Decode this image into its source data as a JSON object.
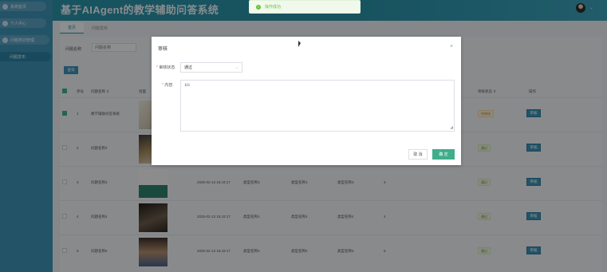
{
  "header": {
    "app_title": "基于AIAgent的教学辅助问答系统",
    "avatar_caret": "⌄"
  },
  "toast": {
    "icon": "✓",
    "text": "操作成功"
  },
  "sidebar": {
    "items": [
      {
        "label": "系统首页"
      },
      {
        "label": "个人中心"
      },
      {
        "label": "问题类别管理"
      },
      {
        "label": "问题发布"
      }
    ]
  },
  "tabs": [
    {
      "label": "首页"
    },
    {
      "label": "问题发布"
    }
  ],
  "search": {
    "label": "问题名称",
    "placeholder": "问题名称",
    "button": "查询"
  },
  "table": {
    "headers": {
      "index": "序号",
      "name": "问题名称 ⇕",
      "cover": "封面",
      "status": "审核状态 ⇕",
      "op": "操作"
    },
    "rows": [
      {
        "index": "1",
        "name": "教学辅助问答系统",
        "status": "待审核",
        "status_type": "pending",
        "op": "审核"
      },
      {
        "index": "2",
        "name": "问题名称2",
        "status": "通过",
        "status_type": "pass",
        "op": "审核"
      },
      {
        "index": "3",
        "name": "问题名称3",
        "date": "2025-02-13 15:43:17",
        "c1": "类型名称3",
        "c2": "类型名称3",
        "c3": "类型名称3",
        "num": "3",
        "status": "通过",
        "status_type": "pass",
        "op": "审核"
      },
      {
        "index": "4",
        "name": "问题名称4",
        "date": "2025-02-13 15:43:17",
        "c1": "类型名称4",
        "c2": "类型名称4",
        "c3": "类型名称4",
        "num": "4",
        "status": "通过",
        "status_type": "pass",
        "op": "审核"
      },
      {
        "index": "5",
        "name": "问题名称5",
        "date": "2025-02-13 15:43:17",
        "c1": "类型名称5",
        "c2": "类型名称5",
        "c3": "类型名称5",
        "num": "5",
        "status": "通过",
        "status_type": "pass",
        "op": "审核"
      }
    ]
  },
  "dialog": {
    "title": "审核",
    "close": "×",
    "status_label": "审核状态",
    "status_value": "通过",
    "content_label": "内容",
    "content_value": "111",
    "cancel": "取 消",
    "confirm": "确 定"
  },
  "colors": {
    "header": "#2a8fa6",
    "sidebar": "#3b8fb0",
    "accent": "#3fae8a",
    "button": "#3c8fb2",
    "success": "#67c23a"
  }
}
